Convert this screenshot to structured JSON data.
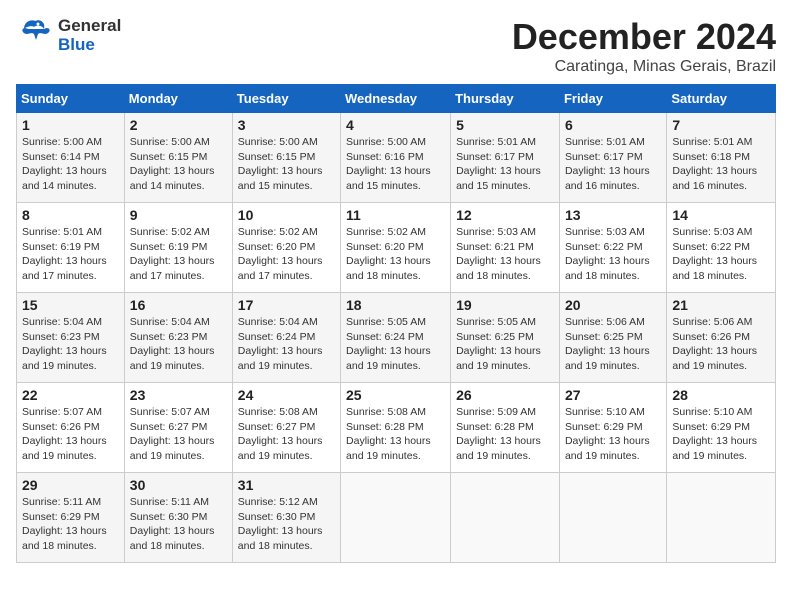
{
  "header": {
    "logo_line1": "General",
    "logo_line2": "Blue",
    "month_title": "December 2024",
    "location": "Caratinga, Minas Gerais, Brazil"
  },
  "days_of_week": [
    "Sunday",
    "Monday",
    "Tuesday",
    "Wednesday",
    "Thursday",
    "Friday",
    "Saturday"
  ],
  "weeks": [
    [
      {
        "day": "1",
        "sunrise": "5:00 AM",
        "sunset": "6:14 PM",
        "daylight": "13 hours and 14 minutes."
      },
      {
        "day": "2",
        "sunrise": "5:00 AM",
        "sunset": "6:15 PM",
        "daylight": "13 hours and 14 minutes."
      },
      {
        "day": "3",
        "sunrise": "5:00 AM",
        "sunset": "6:15 PM",
        "daylight": "13 hours and 15 minutes."
      },
      {
        "day": "4",
        "sunrise": "5:00 AM",
        "sunset": "6:16 PM",
        "daylight": "13 hours and 15 minutes."
      },
      {
        "day": "5",
        "sunrise": "5:01 AM",
        "sunset": "6:17 PM",
        "daylight": "13 hours and 15 minutes."
      },
      {
        "day": "6",
        "sunrise": "5:01 AM",
        "sunset": "6:17 PM",
        "daylight": "13 hours and 16 minutes."
      },
      {
        "day": "7",
        "sunrise": "5:01 AM",
        "sunset": "6:18 PM",
        "daylight": "13 hours and 16 minutes."
      }
    ],
    [
      {
        "day": "8",
        "sunrise": "5:01 AM",
        "sunset": "6:19 PM",
        "daylight": "13 hours and 17 minutes."
      },
      {
        "day": "9",
        "sunrise": "5:02 AM",
        "sunset": "6:19 PM",
        "daylight": "13 hours and 17 minutes."
      },
      {
        "day": "10",
        "sunrise": "5:02 AM",
        "sunset": "6:20 PM",
        "daylight": "13 hours and 17 minutes."
      },
      {
        "day": "11",
        "sunrise": "5:02 AM",
        "sunset": "6:20 PM",
        "daylight": "13 hours and 18 minutes."
      },
      {
        "day": "12",
        "sunrise": "5:03 AM",
        "sunset": "6:21 PM",
        "daylight": "13 hours and 18 minutes."
      },
      {
        "day": "13",
        "sunrise": "5:03 AM",
        "sunset": "6:22 PM",
        "daylight": "13 hours and 18 minutes."
      },
      {
        "day": "14",
        "sunrise": "5:03 AM",
        "sunset": "6:22 PM",
        "daylight": "13 hours and 18 minutes."
      }
    ],
    [
      {
        "day": "15",
        "sunrise": "5:04 AM",
        "sunset": "6:23 PM",
        "daylight": "13 hours and 19 minutes."
      },
      {
        "day": "16",
        "sunrise": "5:04 AM",
        "sunset": "6:23 PM",
        "daylight": "13 hours and 19 minutes."
      },
      {
        "day": "17",
        "sunrise": "5:04 AM",
        "sunset": "6:24 PM",
        "daylight": "13 hours and 19 minutes."
      },
      {
        "day": "18",
        "sunrise": "5:05 AM",
        "sunset": "6:24 PM",
        "daylight": "13 hours and 19 minutes."
      },
      {
        "day": "19",
        "sunrise": "5:05 AM",
        "sunset": "6:25 PM",
        "daylight": "13 hours and 19 minutes."
      },
      {
        "day": "20",
        "sunrise": "5:06 AM",
        "sunset": "6:25 PM",
        "daylight": "13 hours and 19 minutes."
      },
      {
        "day": "21",
        "sunrise": "5:06 AM",
        "sunset": "6:26 PM",
        "daylight": "13 hours and 19 minutes."
      }
    ],
    [
      {
        "day": "22",
        "sunrise": "5:07 AM",
        "sunset": "6:26 PM",
        "daylight": "13 hours and 19 minutes."
      },
      {
        "day": "23",
        "sunrise": "5:07 AM",
        "sunset": "6:27 PM",
        "daylight": "13 hours and 19 minutes."
      },
      {
        "day": "24",
        "sunrise": "5:08 AM",
        "sunset": "6:27 PM",
        "daylight": "13 hours and 19 minutes."
      },
      {
        "day": "25",
        "sunrise": "5:08 AM",
        "sunset": "6:28 PM",
        "daylight": "13 hours and 19 minutes."
      },
      {
        "day": "26",
        "sunrise": "5:09 AM",
        "sunset": "6:28 PM",
        "daylight": "13 hours and 19 minutes."
      },
      {
        "day": "27",
        "sunrise": "5:10 AM",
        "sunset": "6:29 PM",
        "daylight": "13 hours and 19 minutes."
      },
      {
        "day": "28",
        "sunrise": "5:10 AM",
        "sunset": "6:29 PM",
        "daylight": "13 hours and 19 minutes."
      }
    ],
    [
      {
        "day": "29",
        "sunrise": "5:11 AM",
        "sunset": "6:29 PM",
        "daylight": "13 hours and 18 minutes."
      },
      {
        "day": "30",
        "sunrise": "5:11 AM",
        "sunset": "6:30 PM",
        "daylight": "13 hours and 18 minutes."
      },
      {
        "day": "31",
        "sunrise": "5:12 AM",
        "sunset": "6:30 PM",
        "daylight": "13 hours and 18 minutes."
      },
      null,
      null,
      null,
      null
    ]
  ],
  "labels": {
    "sunrise": "Sunrise:",
    "sunset": "Sunset:",
    "daylight": "Daylight:"
  }
}
